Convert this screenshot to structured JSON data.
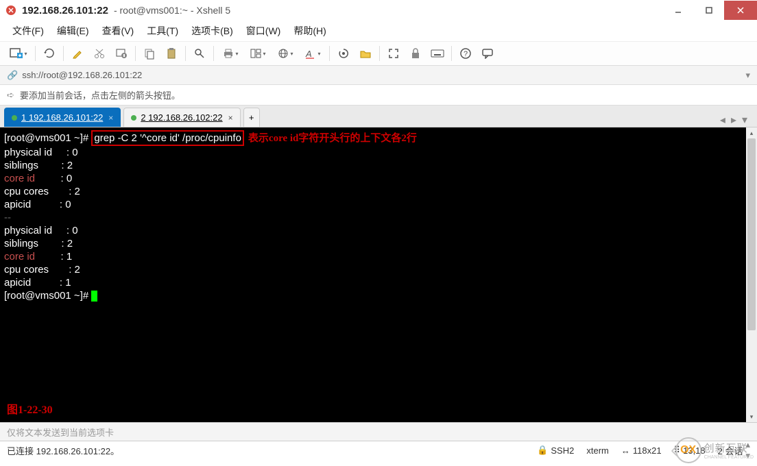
{
  "title": {
    "ip": "192.168.26.101:22",
    "rest": "root@vms001:~ - Xshell 5"
  },
  "menu": [
    "文件(F)",
    "编辑(E)",
    "查看(V)",
    "工具(T)",
    "选项卡(B)",
    "窗口(W)",
    "帮助(H)"
  ],
  "addr": "ssh://root@192.168.26.101:22",
  "tip": "要添加当前会话，点击左侧的箭头按钮。",
  "tabs": [
    {
      "num": "1",
      "label": "192.168.26.101:22",
      "active": true
    },
    {
      "num": "2",
      "label": "192.168.26.102:22",
      "active": false
    }
  ],
  "term": {
    "prompt": "[root@vms001 ~]#",
    "command": "grep -C 2 '^core id' /proc/cpuinfo",
    "annotation": "表示core id字符开头行的上下文各2行",
    "rows": [
      {
        "k": "physical id",
        "v": "0"
      },
      {
        "k": "siblings",
        "v": "2"
      },
      {
        "k": "core id",
        "v": "0",
        "hl": true
      },
      {
        "k": "cpu cores",
        "v": "2"
      },
      {
        "k": "apicid",
        "v": "0"
      }
    ],
    "sep": "--",
    "rows2": [
      {
        "k": "physical id",
        "v": "0"
      },
      {
        "k": "siblings",
        "v": "2"
      },
      {
        "k": "core id",
        "v": "1",
        "hl": true
      },
      {
        "k": "cpu cores",
        "v": "2"
      },
      {
        "k": "apicid",
        "v": "1"
      }
    ],
    "figure": "图1-22-30"
  },
  "sendbar": "仅将文本发送到当前选项卡",
  "status": {
    "conn": "已连接 192.168.26.101:22。",
    "proto": "SSH2",
    "term": "xterm",
    "size": "118x21",
    "pos": "13,18",
    "sess": "2 会话"
  },
  "watermark": {
    "main": "创新互联",
    "sub": "CHANNEL FEATURED"
  }
}
